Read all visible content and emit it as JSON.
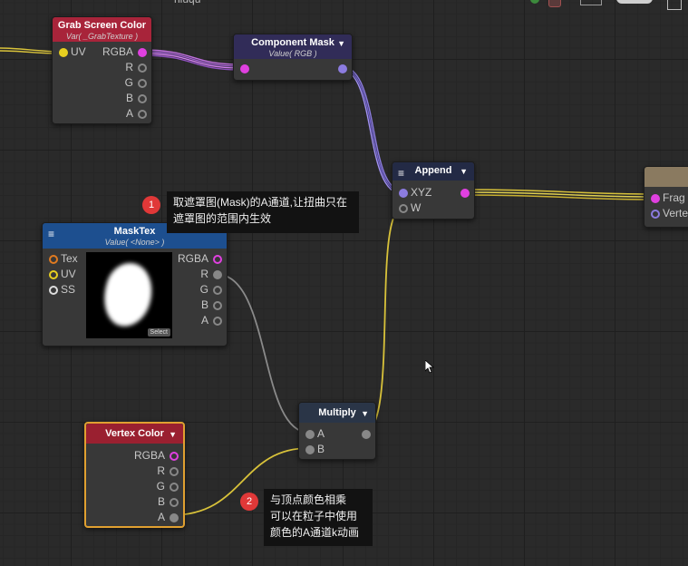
{
  "canvas": {
    "title": "niuqu"
  },
  "nodes": {
    "grab": {
      "title": "Grab Screen Color",
      "subtitle": "Var( _GrabTexture )",
      "in_uv": "UV",
      "out": [
        "RGBA",
        "R",
        "G",
        "B",
        "A"
      ]
    },
    "mask": {
      "title": "Component Mask",
      "subtitle": "Value( RGB )"
    },
    "append": {
      "title": "Append",
      "in": [
        "XYZ",
        "W"
      ]
    },
    "masktex": {
      "title": "MaskTex",
      "subtitle": "Value( <None> )",
      "in": [
        "Tex",
        "UV",
        "SS"
      ],
      "out": [
        "RGBA",
        "R",
        "G",
        "B",
        "A"
      ],
      "select_label": "Select"
    },
    "multiply": {
      "title": "Multiply",
      "in": [
        "A",
        "B"
      ]
    },
    "vertex": {
      "title": "Vertex Color",
      "out": [
        "RGBA",
        "R",
        "G",
        "B",
        "A"
      ]
    },
    "output": {
      "in": [
        "Frag",
        "Verte"
      ]
    }
  },
  "notes": [
    {
      "badge": "1",
      "lines": [
        "取遮罩图(Mask)的A通道,让扭曲只在",
        "遮罩图的范围内生效"
      ]
    },
    {
      "badge": "2",
      "lines": [
        "与顶点颜色相乘",
        "可以在粒子中使用",
        "颜色的A通道k动画"
      ]
    }
  ],
  "colors": {
    "grab_header": "#a8243a",
    "mask_header": "#312c58",
    "append_header": "#232a45",
    "masktex_header": "#1d4f8f",
    "multiply_header": "#2a3547",
    "vertex_header": "#9a2030",
    "vertex_border": "#e0a030",
    "wire_rgb": "#b066d8",
    "wire_yellow": "#d8c23a",
    "wire_gray": "#8a8a8a",
    "port_magenta": "#e040e0",
    "port_yellow": "#e8d020",
    "port_orange": "#e07a20",
    "port_purple": "#8c7ce0"
  }
}
